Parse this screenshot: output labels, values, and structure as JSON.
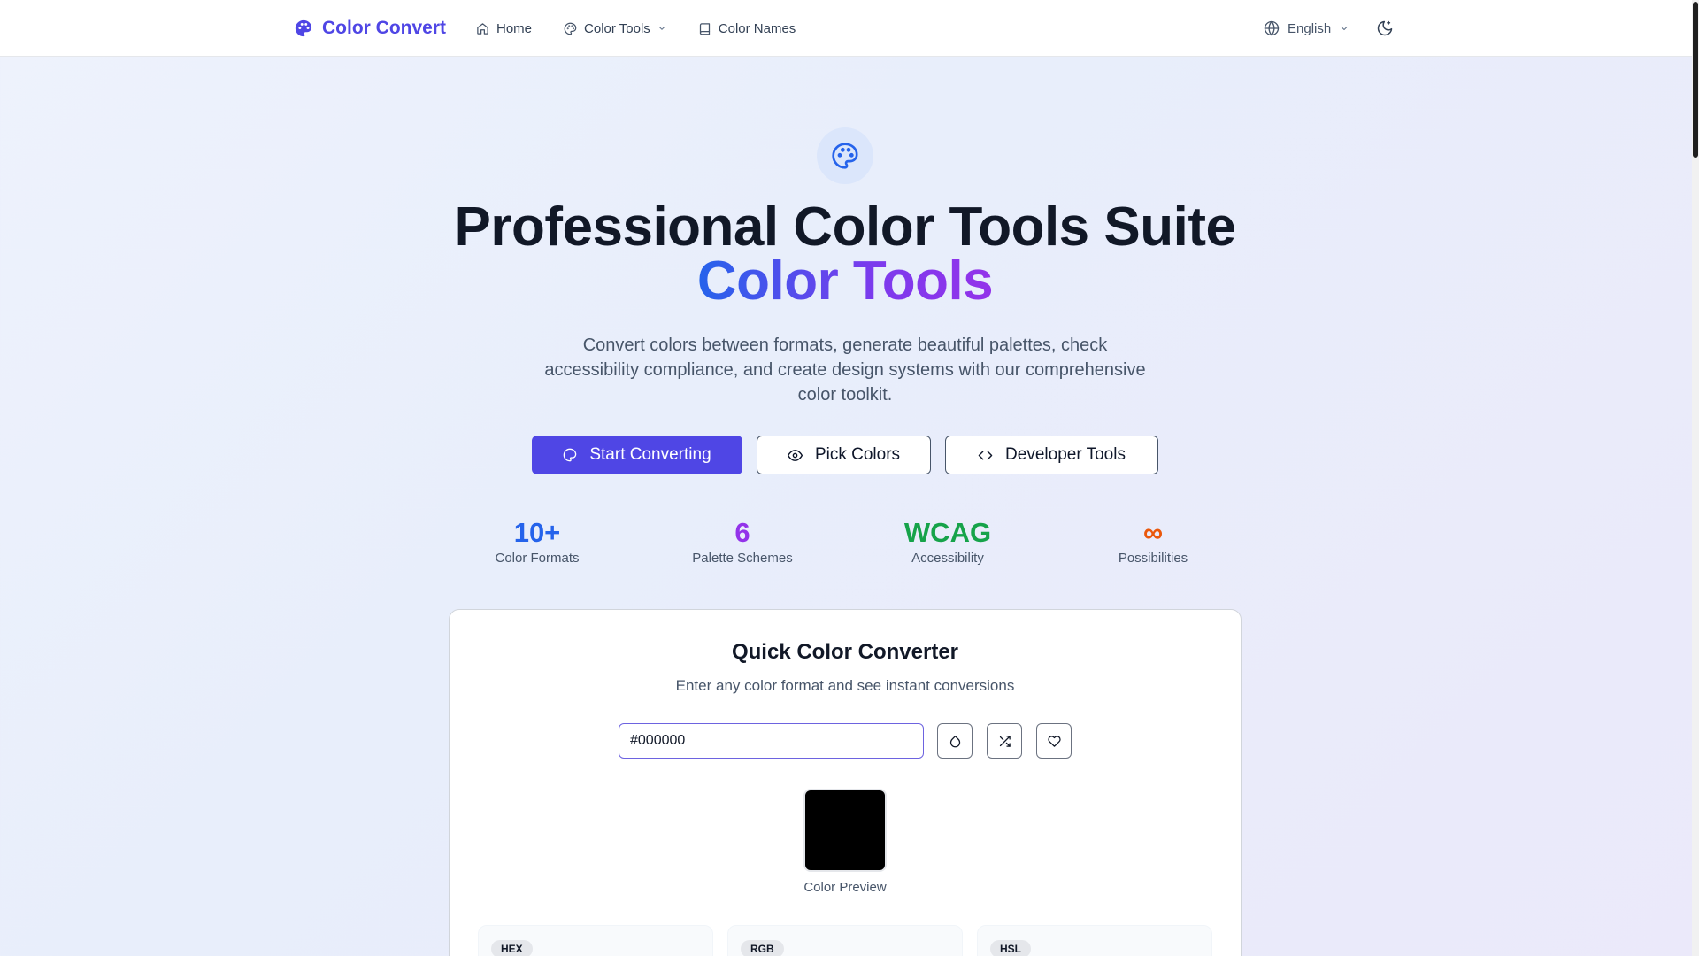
{
  "header": {
    "brand": "Color Convert",
    "nav": [
      {
        "label": "Home",
        "icon": "home-icon"
      },
      {
        "label": "Color Tools",
        "icon": "palette-icon"
      },
      {
        "label": "Color Names",
        "icon": "book-icon"
      }
    ],
    "language": "English"
  },
  "hero": {
    "title_line1": "Professional Color Tools Suite",
    "title_line2": "Color Tools",
    "subtitle": "Convert colors between formats, generate beautiful palettes, check accessibility compliance, and create design systems with our comprehensive color toolkit.",
    "buttons": {
      "start": "Start Converting",
      "pick": "Pick Colors",
      "dev": "Developer Tools"
    }
  },
  "stats": [
    {
      "value": "10+",
      "label": "Color Formats",
      "color": "#2563eb"
    },
    {
      "value": "6",
      "label": "Palette Schemes",
      "color": "#9333ea"
    },
    {
      "value": "WCAG",
      "label": "Accessibility",
      "color": "#16a34a"
    },
    {
      "value": "∞",
      "label": "Possibilities",
      "color": "#ea580c"
    }
  ],
  "converter": {
    "title": "Quick Color Converter",
    "subtitle": "Enter any color format and see instant conversions",
    "input_value": "#000000",
    "preview_color": "#000000",
    "preview_label": "Color Preview",
    "formats": [
      "HEX",
      "RGB",
      "HSL"
    ]
  },
  "colors": {
    "brand": "#4f46e5",
    "primary_button": "#4f46e5"
  }
}
